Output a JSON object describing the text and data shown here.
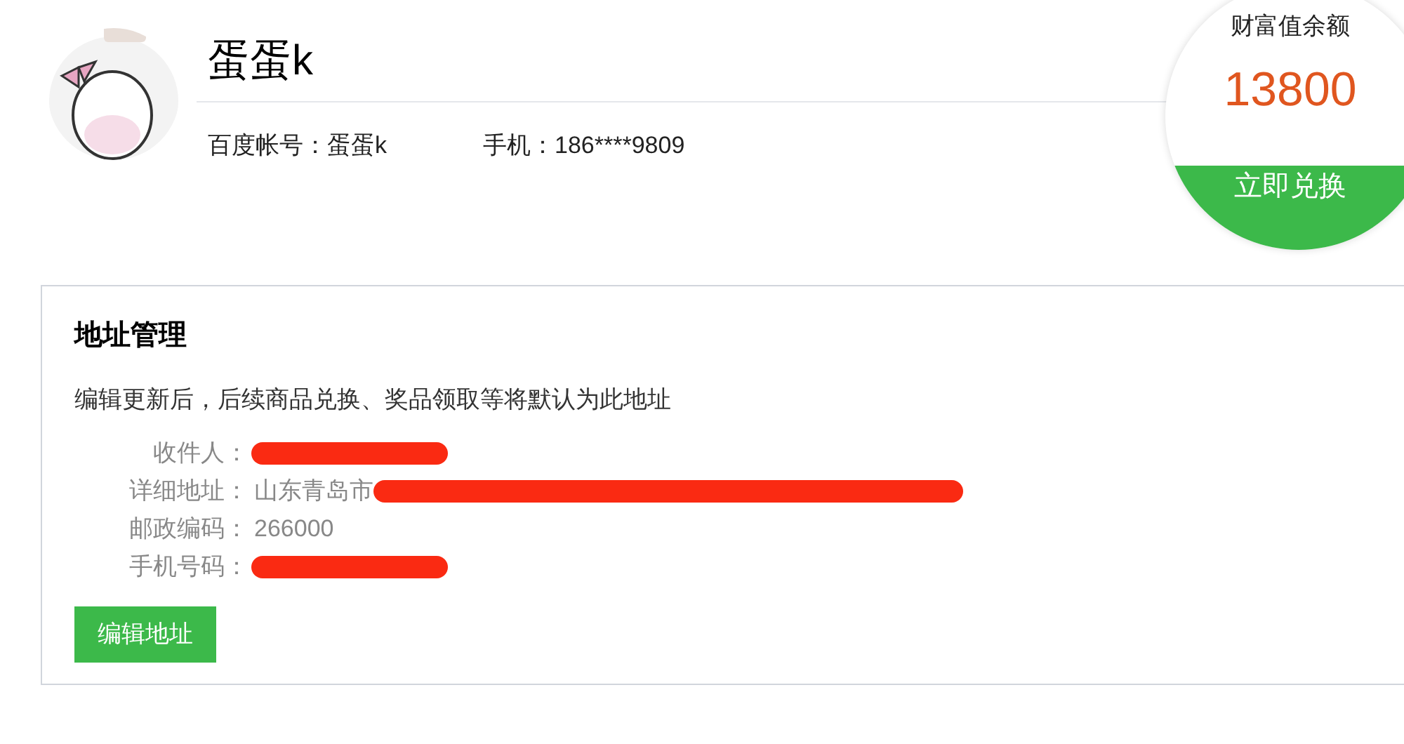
{
  "profile": {
    "name": "蛋蛋k",
    "account": "百度帐号：蛋蛋k",
    "phone": "手机：186****9809"
  },
  "wealth": {
    "title": "财富值余额",
    "amount": "13800",
    "button": "立即兑换"
  },
  "address": {
    "title": "地址管理",
    "note": "编辑更新后，后续商品兑换、奖品领取等将默认为此地址",
    "rows": [
      {
        "label": "收件人：",
        "redacted": true
      },
      {
        "label": "详细地址：",
        "value": "山东青岛市",
        "redacted": true
      },
      {
        "label": "邮政编码：",
        "value": "266000",
        "redacted": false
      },
      {
        "label": "手机号码：",
        "redacted": true
      }
    ],
    "button": "编辑地址"
  }
}
